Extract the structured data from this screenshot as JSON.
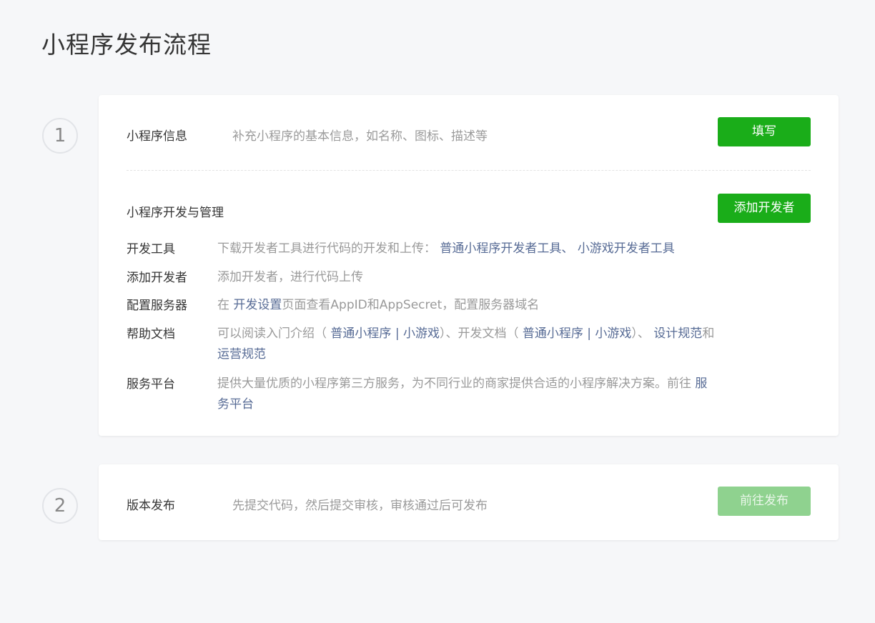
{
  "page_title": "小程序发布流程",
  "steps": [
    {
      "number": "1",
      "info": {
        "label": "小程序信息",
        "desc": "补充小程序的基本信息，如名称、图标、描述等",
        "button": "填写"
      },
      "dev": {
        "label": "小程序开发与管理",
        "button": "添加开发者",
        "rows": {
          "tools": {
            "label": "开发工具",
            "text": "下载开发者工具进行代码的开发和上传：",
            "link1": "普通小程序开发者工具",
            "sep": "、",
            "link2": "小游戏开发者工具"
          },
          "add_dev": {
            "label": "添加开发者",
            "text": "添加开发者，进行代码上传"
          },
          "server": {
            "label": "配置服务器",
            "prefix": "在",
            "link": "开发设置",
            "suffix": "页面查看AppID和AppSecret，配置服务器域名"
          },
          "help": {
            "label": "帮助文档",
            "t1": "可以阅读入门介绍（",
            "l1": "普通小程序",
            "pipe1": "|",
            "l2": "小游戏",
            "t2": "）、开发文档（",
            "l3": "普通小程序",
            "pipe2": "|",
            "l4": "小游戏",
            "t3": "）、",
            "l5": "设计规范",
            "t4": "和",
            "l6": "运营规范"
          },
          "platform": {
            "label": "服务平台",
            "text": "提供大量优质的小程序第三方服务，为不同行业的商家提供合适的小程序解决方案。前往",
            "link": "服务平台"
          }
        }
      }
    },
    {
      "number": "2",
      "release": {
        "label": "版本发布",
        "desc": "先提交代码，然后提交审核，审核通过后可发布",
        "button": "前往发布"
      }
    }
  ],
  "colors": {
    "accent": "#1aad19",
    "accent_disabled": "#8fd28f",
    "link": "#576b95",
    "muted": "#9a9a9a",
    "background": "#f6f7f9"
  }
}
